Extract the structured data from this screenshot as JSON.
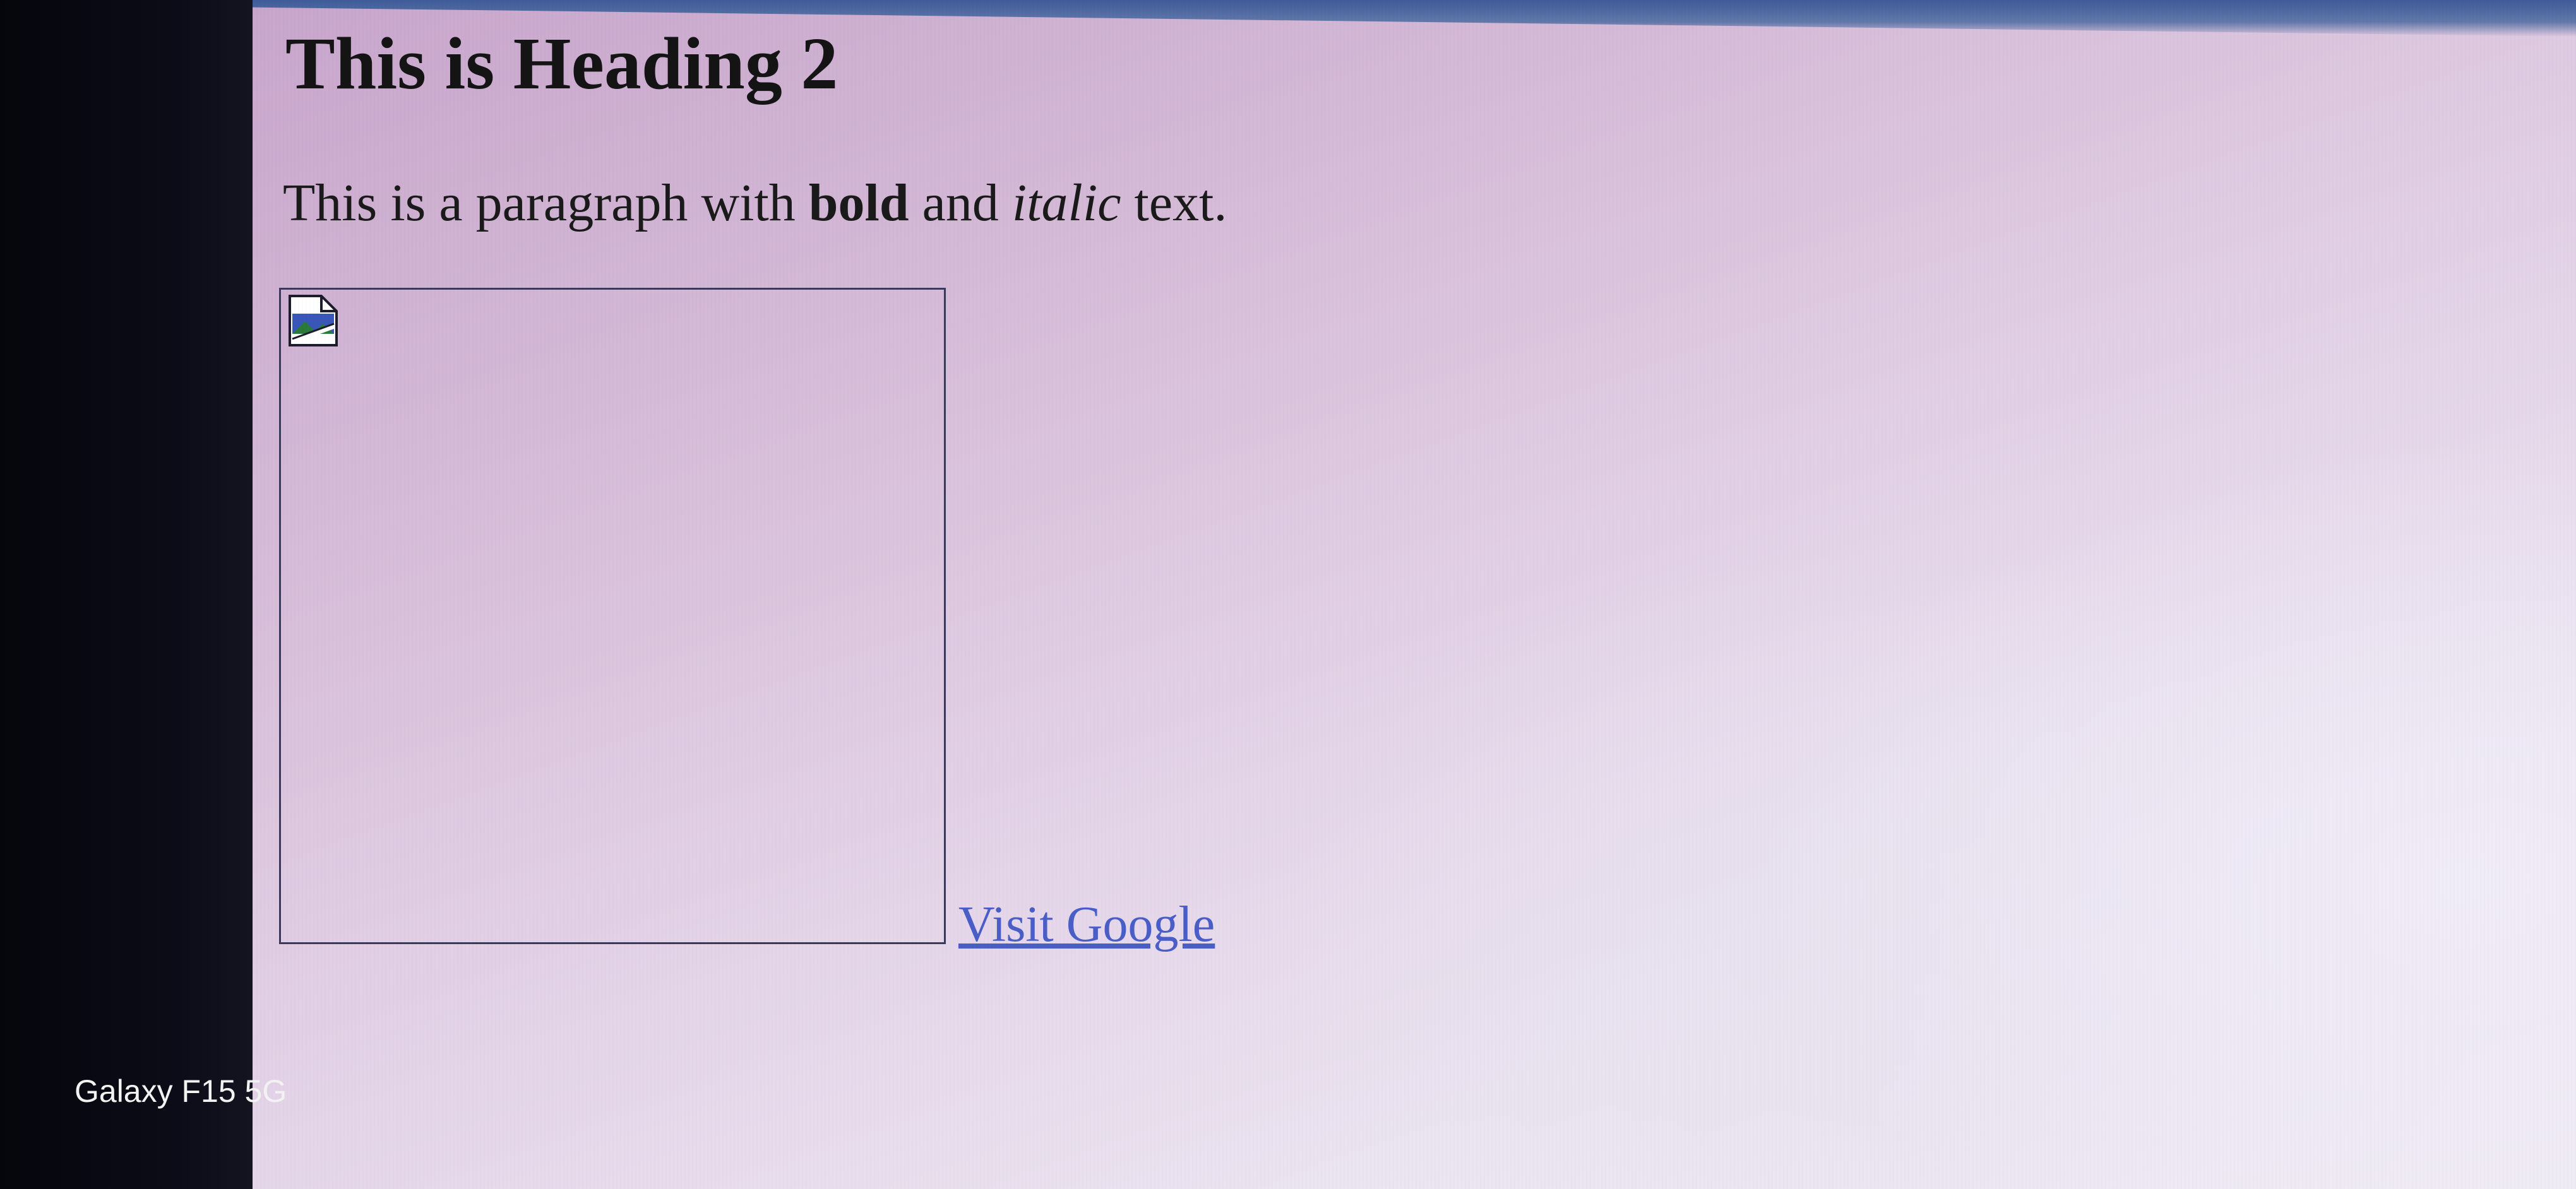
{
  "page": {
    "heading": "This is Heading 2",
    "paragraph": {
      "before_bold": "This is a paragraph with ",
      "bold": "bold",
      "between": " and ",
      "italic": "italic",
      "after": " text."
    },
    "image": {
      "state": "broken",
      "icon": "broken-image-icon"
    },
    "link": {
      "label": "Visit Google"
    }
  },
  "photo_overlay": {
    "watermark": "Galaxy F15 5G"
  },
  "colors": {
    "link": "#4a5ec8",
    "text": "#141414",
    "screen_tint": "#d6bcd8"
  }
}
